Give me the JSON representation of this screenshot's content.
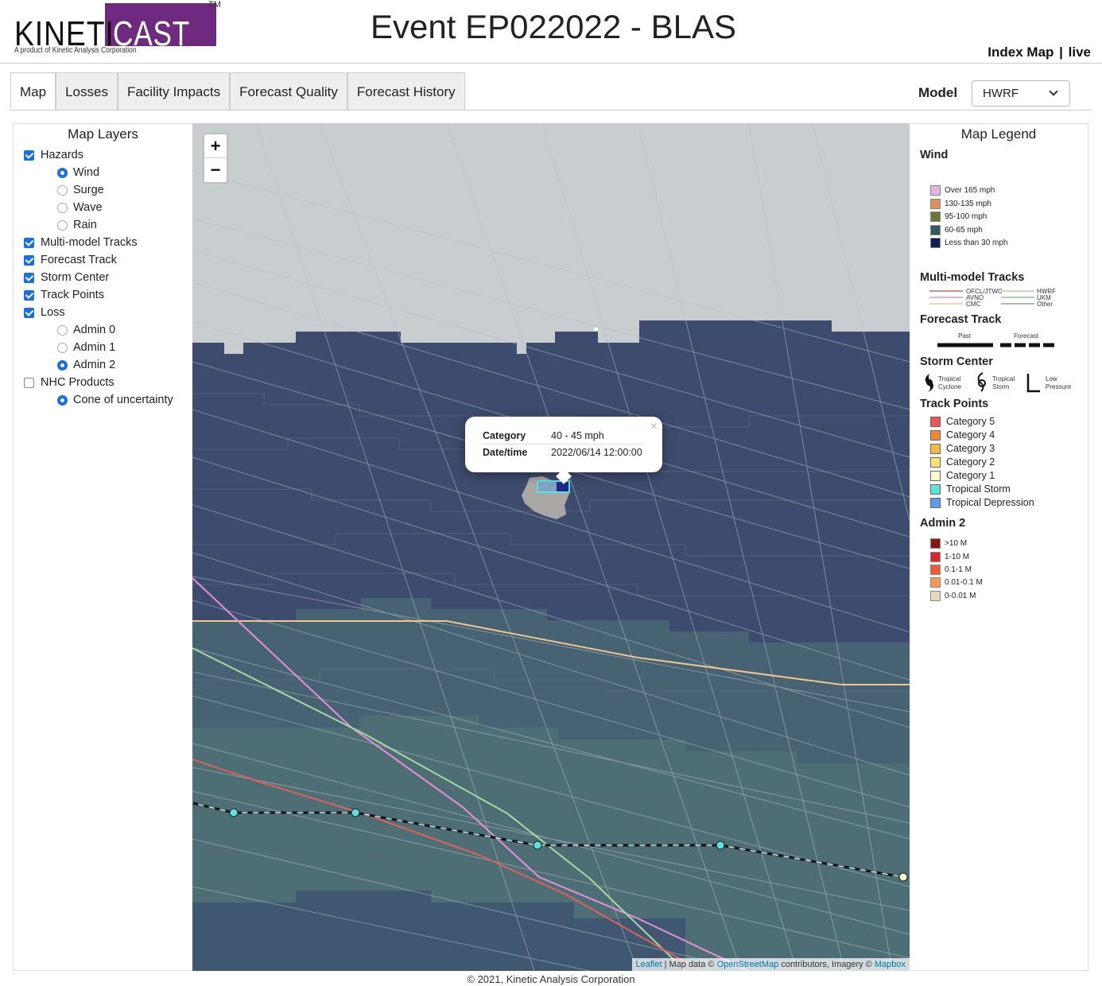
{
  "header": {
    "logo_main": "KINETI",
    "logo_cast": "CAST",
    "logo_tm": "TM",
    "logo_sub": "A product of Kinetic Analysis Corporation",
    "title": "Event EP022022 - BLAS",
    "link_index": "Index Map",
    "link_sep": "|",
    "link_live": "live"
  },
  "tabs": [
    {
      "label": "Map",
      "active": true
    },
    {
      "label": "Losses"
    },
    {
      "label": "Facility Impacts"
    },
    {
      "label": "Forecast Quality"
    },
    {
      "label": "Forecast History"
    }
  ],
  "model": {
    "label": "Model",
    "selected": "HWRF"
  },
  "layers": {
    "title": "Map Layers",
    "hazards": "Hazards",
    "wind": "Wind",
    "surge": "Surge",
    "wave": "Wave",
    "rain": "Rain",
    "multi_model": "Multi-model Tracks",
    "forecast_track": "Forecast Track",
    "storm_center": "Storm Center",
    "track_points": "Track Points",
    "loss": "Loss",
    "admin0": "Admin 0",
    "admin1": "Admin 1",
    "admin2": "Admin 2",
    "nhc": "NHC Products",
    "cone": "Cone of uncertainty"
  },
  "map": {
    "zoom_in": "+",
    "zoom_out": "−",
    "popup": {
      "category_label": "Category",
      "category_value": "40 - 45 mph",
      "datetime_label": "Date/time",
      "datetime_value": "2022/06/14 12:00:00",
      "close": "×"
    },
    "attribution": {
      "leaflet": "Leaflet",
      "sep": " | Map data © ",
      "osm": "OpenStreetMap",
      "mid": " contributors, Imagery © ",
      "mapbox": "Mapbox"
    }
  },
  "legend": {
    "title": "Map Legend",
    "wind_title": "Wind",
    "wind": [
      {
        "label": "Over 165 mph",
        "color": "#e2b4e0"
      },
      {
        "label": "130-135 mph",
        "color": "#d9925a"
      },
      {
        "label": "95-100 mph",
        "color": "#6b7535"
      },
      {
        "label": "60-65 mph",
        "color": "#2f5b5e"
      },
      {
        "label": "Less than 30 mph",
        "color": "#141c58"
      }
    ],
    "mm_title": "Multi-model Tracks",
    "mm": [
      {
        "label": "OFCL/JTWC",
        "color": "#e0605a"
      },
      {
        "label": "AVNO",
        "color": "#e58fd8"
      },
      {
        "label": "CMC",
        "color": "#f1c590"
      },
      {
        "label": "HWRF",
        "color": "#a8d8a0"
      },
      {
        "label": "UKM",
        "color": "#86c88a"
      },
      {
        "label": "Other",
        "color": "#999999"
      }
    ],
    "ft_title": "Forecast Track",
    "ft_past": "Past",
    "ft_forecast": "Forecast",
    "sc_title": "Storm Center",
    "sc_tc_1": "Tropical",
    "sc_tc_2": "Cyclone",
    "sc_ts_1": "Tropical",
    "sc_ts_2": "Storm",
    "sc_lp_1": "Low",
    "sc_lp_2": "Pressure",
    "tp_title": "Track Points",
    "tp": [
      {
        "label": "Category 5",
        "color": "#e8555a"
      },
      {
        "label": "Category 4",
        "color": "#f08a35"
      },
      {
        "label": "Category 3",
        "color": "#f5b94a"
      },
      {
        "label": "Category 2",
        "color": "#f7e27a"
      },
      {
        "label": "Category 1",
        "color": "#fdf8c8"
      },
      {
        "label": "Tropical Storm",
        "color": "#5ee0e0"
      },
      {
        "label": "Tropical Depression",
        "color": "#5a9ee8"
      }
    ],
    "admin2_title": "Admin 2",
    "admin2": [
      {
        "label": ">10 M",
        "color": "#8b1414"
      },
      {
        "label": "1-10 M",
        "color": "#d8262a"
      },
      {
        "label": "0.1-1 M",
        "color": "#ee5a36"
      },
      {
        "label": "0.01-0.1 M",
        "color": "#f49a52"
      },
      {
        "label": "0-0.01 M",
        "color": "#e5d8bc"
      }
    ]
  },
  "footer": "© 2021, Kinetic Analysis Corporation"
}
